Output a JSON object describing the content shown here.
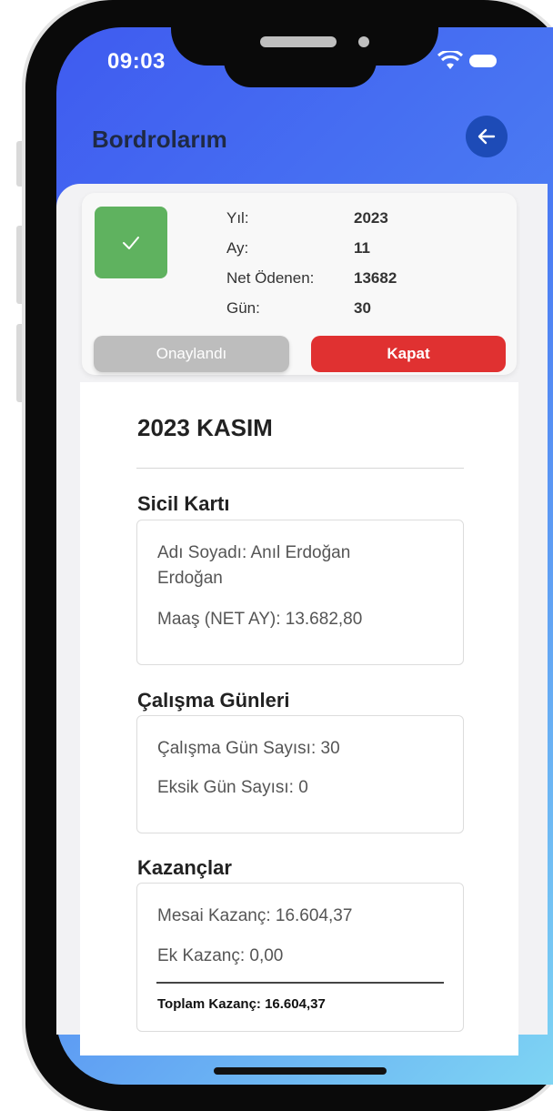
{
  "status_bar": {
    "time": "09:03"
  },
  "header": {
    "title": "Bordrolarım"
  },
  "summary": {
    "rows": [
      {
        "label": "Yıl:",
        "value": "2023"
      },
      {
        "label": "Ay:",
        "value": "11"
      },
      {
        "label": "Net Ödenen:",
        "value": "13682"
      },
      {
        "label": "Gün:",
        "value": "30"
      }
    ],
    "approved_label": "Onaylandı",
    "close_label": "Kapat"
  },
  "detail": {
    "period_title": "2023 KASIM",
    "sicil": {
      "title": "Sicil Kartı",
      "name_line1": "Adı Soyadı: Anıl Erdoğan",
      "name_line2": "Erdoğan",
      "salary": "Maaş (NET AY): 13.682,80"
    },
    "work_days": {
      "title": "Çalışma Günleri",
      "days": "Çalışma Gün Sayısı: 30",
      "missing": "Eksik Gün Sayısı: 0"
    },
    "earnings": {
      "title": "Kazançlar",
      "overtime": "Mesai Kazanç: 16.604,37",
      "extra": "Ek Kazanç: 0,00",
      "total": "Toplam Kazanç: 16.604,37"
    }
  },
  "colors": {
    "accent": "#1d4bb7",
    "approved_green": "#5fb25f",
    "close_red": "#e03131",
    "approved_gray": "#bdbdbd"
  }
}
